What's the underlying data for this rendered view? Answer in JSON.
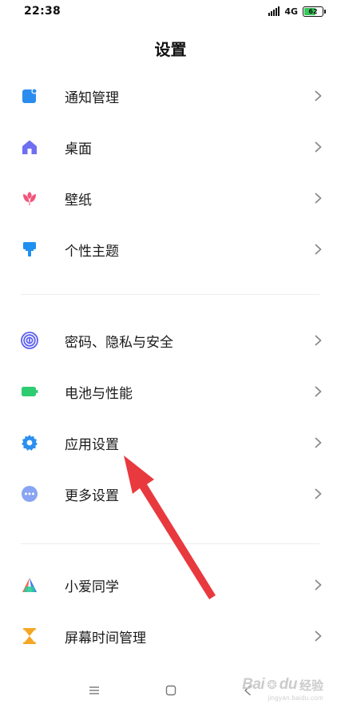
{
  "status_bar": {
    "time": "22:38",
    "network": "4G",
    "battery": "62",
    "battery_level": 0.62
  },
  "header": {
    "title": "设置"
  },
  "sections": [
    {
      "items": [
        {
          "label": "通知管理",
          "icon": "notification-icon",
          "color": "#2b8cf0"
        },
        {
          "label": "桌面",
          "icon": "home-icon",
          "color": "#6f6ff2"
        },
        {
          "label": "壁纸",
          "icon": "tulip-icon",
          "color": "#f2557a"
        },
        {
          "label": "个性主题",
          "icon": "brush-icon",
          "color": "#1f8ff0"
        }
      ]
    },
    {
      "items": [
        {
          "label": "密码、隐私与安全",
          "icon": "fingerprint-icon",
          "color": "#5b5ff0"
        },
        {
          "label": "电池与性能",
          "icon": "battery-icon",
          "color": "#2ecc71"
        },
        {
          "label": "应用设置",
          "icon": "gear-icon",
          "color": "#2a8ff0"
        },
        {
          "label": "更多设置",
          "icon": "more-icon",
          "color": "#6a8df0"
        }
      ]
    },
    {
      "items": [
        {
          "label": "小爱同学",
          "icon": "xiaoai-icon",
          "color": "#5a6cf5"
        },
        {
          "label": "屏幕时间管理",
          "icon": "hourglass-icon",
          "color": "#f5a623"
        }
      ]
    }
  ],
  "watermark": {
    "brand": "Bai",
    "brand_suffix": "du",
    "cn": "经验",
    "url": "jingyan.baidu.com"
  },
  "colors": {
    "accent": "#2a8ff0",
    "arrow": "#e8393f"
  }
}
